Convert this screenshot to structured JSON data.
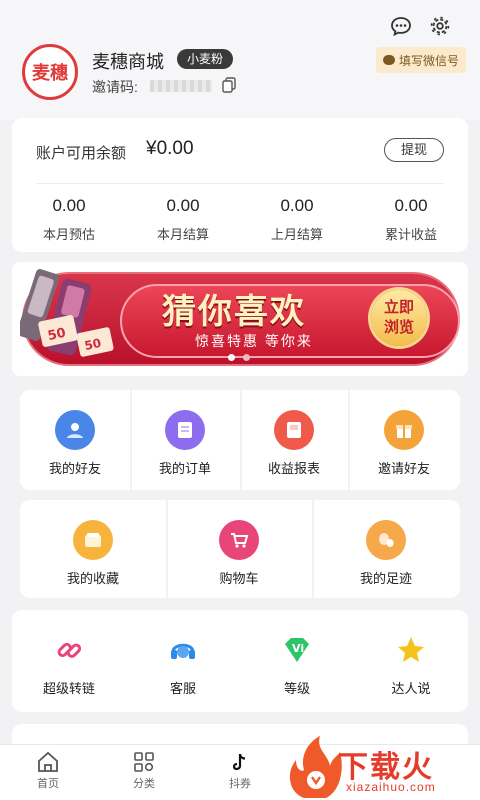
{
  "header": {
    "logo_text": "麦穗",
    "shop_name": "麦穗商城",
    "role_badge": "小麦粉",
    "invite_label": "邀请码:",
    "wechat_button": "填写微信号"
  },
  "balance": {
    "label": "账户可用余额",
    "value": "¥0.00",
    "withdraw_label": "提现",
    "stats": [
      {
        "value": "0.00",
        "label": "本月预估"
      },
      {
        "value": "0.00",
        "label": "本月结算"
      },
      {
        "value": "0.00",
        "label": "上月结算"
      },
      {
        "value": "0.00",
        "label": "累计收益"
      }
    ]
  },
  "banner": {
    "title": "猜你喜欢",
    "subtitle": "惊喜特惠 等你来",
    "cta_line1": "立即",
    "cta_line2": "浏览",
    "coupon_values": [
      "50",
      "50"
    ]
  },
  "menu1": [
    {
      "label": "我的好友",
      "icon": "friends-icon",
      "color": "#4a86e8"
    },
    {
      "label": "我的订单",
      "icon": "orders-icon",
      "color": "#8e6cf0"
    },
    {
      "label": "收益报表",
      "icon": "report-icon",
      "color": "#f05a4a"
    },
    {
      "label": "邀请好友",
      "icon": "gift-icon",
      "color": "#f4a23a"
    }
  ],
  "menu2": [
    {
      "label": "我的收藏",
      "icon": "wallet-icon",
      "color": "#f6b43c"
    },
    {
      "label": "购物车",
      "icon": "cart-icon",
      "color": "#e8457a"
    },
    {
      "label": "我的足迹",
      "icon": "footprint-icon",
      "color": "#f6a94a"
    }
  ],
  "menu3": [
    {
      "label": "超级转链",
      "icon": "link-icon",
      "color": "#e8457a"
    },
    {
      "label": "客服",
      "icon": "headset-icon",
      "color": "#2b8be8"
    },
    {
      "label": "等级",
      "icon": "vip-diamond-icon",
      "color": "#2fc468"
    },
    {
      "label": "达人说",
      "icon": "star-icon",
      "color": "#f6c21c"
    }
  ],
  "nav": [
    {
      "label": "首页",
      "icon": "home-icon"
    },
    {
      "label": "分类",
      "icon": "category-icon"
    },
    {
      "label": "抖券",
      "icon": "tiktok-icon"
    }
  ],
  "watermark": {
    "text": "下载火",
    "url": "xiazaihuo.com"
  },
  "colors": {
    "brand_red": "#e23a3a",
    "background": "#f2f2f4"
  }
}
